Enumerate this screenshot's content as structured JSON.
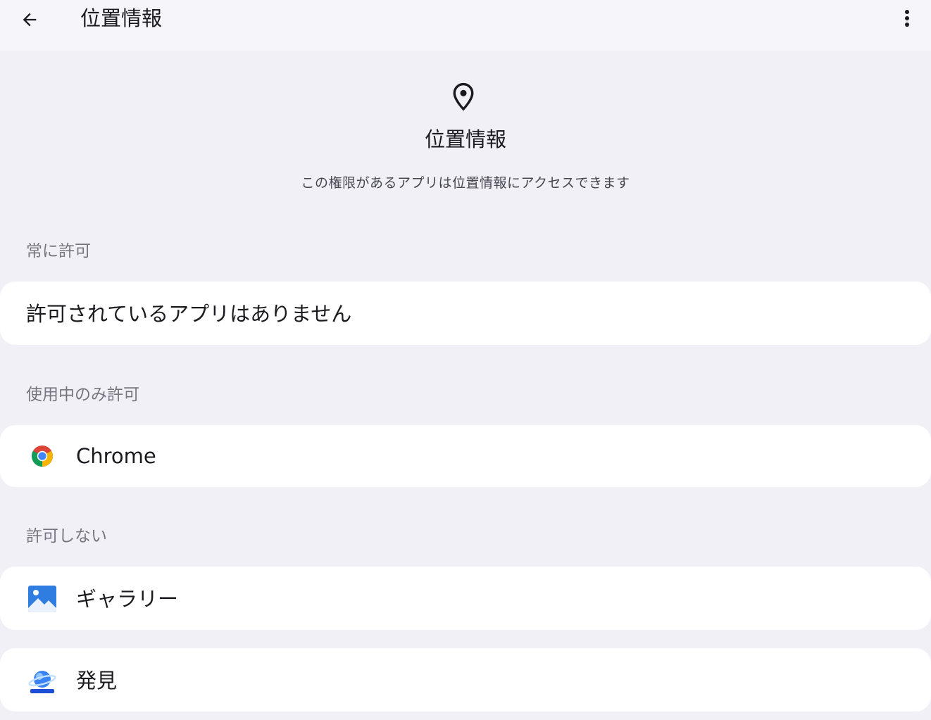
{
  "appbar": {
    "title": "位置情報",
    "back_icon": "arrow-back-icon",
    "more_icon": "more-vert-icon"
  },
  "header": {
    "icon": "location-pin-icon",
    "title": "位置情報",
    "description": "この権限があるアプリは位置情報にアクセスできます"
  },
  "sections": {
    "always": {
      "label": "常に許可",
      "empty_text": "許可されているアプリはありません"
    },
    "while_in_use": {
      "label": "使用中のみ許可",
      "apps": [
        {
          "name": "Chrome",
          "icon": "chrome-icon"
        }
      ]
    },
    "denied": {
      "label": "許可しない",
      "apps": [
        {
          "name": "ギャラリー",
          "icon": "gallery-icon"
        },
        {
          "name": "発見",
          "icon": "discover-icon"
        }
      ]
    }
  },
  "colors": {
    "background": "#f1f0f7",
    "card": "#ffffff",
    "section_label": "#77767f",
    "text_primary": "#1b1b1f"
  }
}
